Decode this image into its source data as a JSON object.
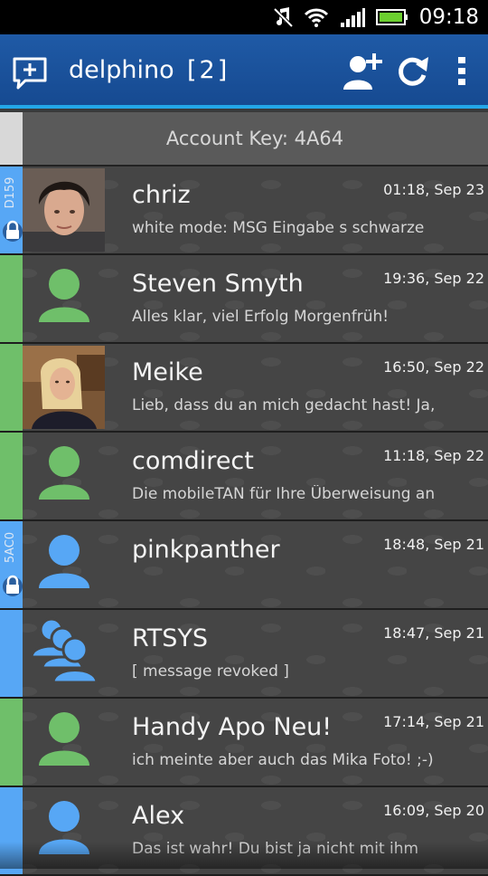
{
  "status_bar": {
    "time": "09:18",
    "icons": [
      "music-muted-icon",
      "wifi-icon",
      "signal-icon",
      "battery-icon"
    ]
  },
  "app_bar": {
    "title": "delphino",
    "count": "[2]",
    "actions": [
      "new-chat-icon",
      "add-contact-icon",
      "refresh-icon",
      "overflow-menu-icon"
    ],
    "accent_color": "#23a7e8",
    "bar_color": "#1a529c"
  },
  "account": {
    "key_label": "Account Key: 4A64"
  },
  "conversations": [
    {
      "name": "chriz",
      "time": "01:18, Sep 23",
      "preview": "white mode: MSG Eingabe s schwarze",
      "stripe": "blue",
      "key_tag": "D159",
      "locked": true,
      "avatar": "photo-young-man"
    },
    {
      "name": "Steven Smyth",
      "time": "19:36, Sep 22",
      "preview": "Alles klar, viel Erfolg Morgenfrüh!",
      "stripe": "green",
      "key_tag": "",
      "locked": false,
      "avatar": "person-green-icon"
    },
    {
      "name": "Meike",
      "time": "16:50, Sep 22",
      "preview": "Lieb, dass du an mich gedacht hast! Ja,",
      "stripe": "green",
      "key_tag": "",
      "locked": false,
      "avatar": "photo-woman"
    },
    {
      "name": "comdirect",
      "time": "11:18, Sep 22",
      "preview": "Die mobileTAN für Ihre Überweisung an",
      "stripe": "green",
      "key_tag": "",
      "locked": false,
      "avatar": "person-green-icon"
    },
    {
      "name": "pinkpanther",
      "time": "18:48, Sep 21",
      "preview": "",
      "stripe": "blue",
      "key_tag": "5AC0",
      "locked": true,
      "avatar": "person-blue-icon"
    },
    {
      "name": "RTSYS",
      "time": "18:47, Sep 21",
      "preview": "[ message revoked ]",
      "stripe": "blue",
      "key_tag": "",
      "locked": false,
      "avatar": "group-blue-icon"
    },
    {
      "name": "Handy Apo Neu!",
      "time": "17:14, Sep 21",
      "preview": "ich meinte aber auch das Mika Foto! ;-)",
      "stripe": "green",
      "key_tag": "",
      "locked": false,
      "avatar": "person-green-icon"
    },
    {
      "name": "Alex",
      "time": "16:09, Sep 20",
      "preview": "Das ist wahr! Du bist ja nicht mit ihm",
      "stripe": "blue",
      "key_tag": "",
      "locked": false,
      "avatar": "person-blue-icon"
    }
  ]
}
